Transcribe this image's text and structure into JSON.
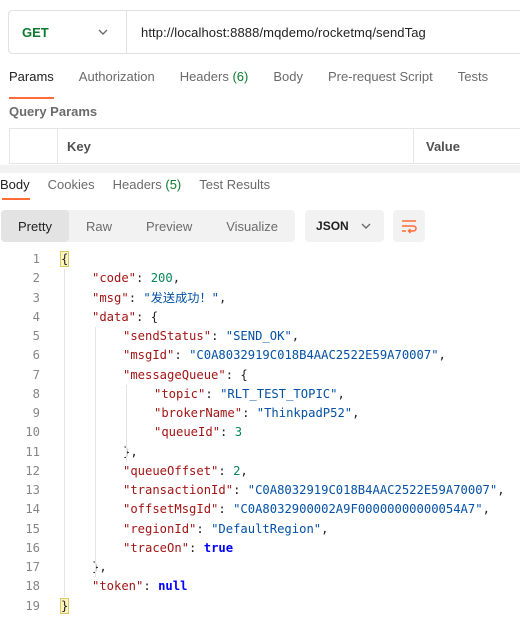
{
  "request": {
    "method": "GET",
    "url": "http://localhost:8888/mqdemo/rocketmq/sendTag"
  },
  "request_tabs": [
    {
      "label": "Params",
      "count": ""
    },
    {
      "label": "Authorization",
      "count": ""
    },
    {
      "label": "Headers",
      "count": "(6)"
    },
    {
      "label": "Body",
      "count": ""
    },
    {
      "label": "Pre-request Script",
      "count": ""
    },
    {
      "label": "Tests",
      "count": ""
    }
  ],
  "query_params": {
    "title": "Query Params",
    "columns": {
      "key": "Key",
      "value": "Value"
    }
  },
  "response_tabs": [
    {
      "label": "Body",
      "count": ""
    },
    {
      "label": "Cookies",
      "count": ""
    },
    {
      "label": "Headers",
      "count": "(5)"
    },
    {
      "label": "Test Results",
      "count": ""
    }
  ],
  "view_modes": [
    "Pretty",
    "Raw",
    "Preview",
    "Visualize"
  ],
  "active_view": "Pretty",
  "format": "JSON",
  "icons": {
    "method_dropdown": "chevron-down-icon",
    "format_dropdown": "chevron-down-icon",
    "wrap": "wrap-lines-icon"
  },
  "colors": {
    "accent": "#ff6c37",
    "get_method": "#0c7b2f",
    "json_key": "#a31515",
    "json_string": "#0451a5",
    "json_number": "#098658",
    "json_literal": "#0000ff"
  },
  "code_lines": [
    {
      "n": "1",
      "depth": 0,
      "tokens": [
        {
          "t": "{",
          "c": "p",
          "hl": true
        }
      ]
    },
    {
      "n": "2",
      "depth": 1,
      "tokens": [
        {
          "t": "\"code\"",
          "c": "k"
        },
        {
          "t": ": ",
          "c": "p"
        },
        {
          "t": "200",
          "c": "n"
        },
        {
          "t": ",",
          "c": "p"
        }
      ]
    },
    {
      "n": "3",
      "depth": 1,
      "tokens": [
        {
          "t": "\"msg\"",
          "c": "k"
        },
        {
          "t": ": ",
          "c": "p"
        },
        {
          "t": "\"发送成功！\"",
          "c": "s"
        },
        {
          "t": ",",
          "c": "p"
        }
      ]
    },
    {
      "n": "4",
      "depth": 1,
      "tokens": [
        {
          "t": "\"data\"",
          "c": "k"
        },
        {
          "t": ": {",
          "c": "p"
        }
      ]
    },
    {
      "n": "5",
      "depth": 2,
      "tokens": [
        {
          "t": "\"sendStatus\"",
          "c": "k"
        },
        {
          "t": ": ",
          "c": "p"
        },
        {
          "t": "\"SEND_OK\"",
          "c": "s"
        },
        {
          "t": ",",
          "c": "p"
        }
      ]
    },
    {
      "n": "6",
      "depth": 2,
      "tokens": [
        {
          "t": "\"msgId\"",
          "c": "k"
        },
        {
          "t": ": ",
          "c": "p"
        },
        {
          "t": "\"C0A8032919C018B4AAC2522E59A70007\"",
          "c": "s"
        },
        {
          "t": ",",
          "c": "p"
        }
      ]
    },
    {
      "n": "7",
      "depth": 2,
      "tokens": [
        {
          "t": "\"messageQueue\"",
          "c": "k"
        },
        {
          "t": ": {",
          "c": "p"
        }
      ]
    },
    {
      "n": "8",
      "depth": 3,
      "tokens": [
        {
          "t": "\"topic\"",
          "c": "k"
        },
        {
          "t": ": ",
          "c": "p"
        },
        {
          "t": "\"RLT_TEST_TOPIC\"",
          "c": "s"
        },
        {
          "t": ",",
          "c": "p"
        }
      ]
    },
    {
      "n": "9",
      "depth": 3,
      "tokens": [
        {
          "t": "\"brokerName\"",
          "c": "k"
        },
        {
          "t": ": ",
          "c": "p"
        },
        {
          "t": "\"ThinkpadP52\"",
          "c": "s"
        },
        {
          "t": ",",
          "c": "p"
        }
      ]
    },
    {
      "n": "10",
      "depth": 3,
      "tokens": [
        {
          "t": "\"queueId\"",
          "c": "k"
        },
        {
          "t": ": ",
          "c": "p"
        },
        {
          "t": "3",
          "c": "n"
        }
      ]
    },
    {
      "n": "11",
      "depth": 2,
      "tokens": [
        {
          "t": "},",
          "c": "p"
        }
      ]
    },
    {
      "n": "12",
      "depth": 2,
      "tokens": [
        {
          "t": "\"queueOffset\"",
          "c": "k"
        },
        {
          "t": ": ",
          "c": "p"
        },
        {
          "t": "2",
          "c": "n"
        },
        {
          "t": ",",
          "c": "p"
        }
      ]
    },
    {
      "n": "13",
      "depth": 2,
      "tokens": [
        {
          "t": "\"transactionId\"",
          "c": "k"
        },
        {
          "t": ": ",
          "c": "p"
        },
        {
          "t": "\"C0A8032919C018B4AAC2522E59A70007\"",
          "c": "s"
        },
        {
          "t": ",",
          "c": "p"
        }
      ]
    },
    {
      "n": "14",
      "depth": 2,
      "tokens": [
        {
          "t": "\"offsetMsgId\"",
          "c": "k"
        },
        {
          "t": ": ",
          "c": "p"
        },
        {
          "t": "\"C0A8032900002A9F00000000000054A7\"",
          "c": "s"
        },
        {
          "t": ",",
          "c": "p"
        }
      ]
    },
    {
      "n": "15",
      "depth": 2,
      "tokens": [
        {
          "t": "\"regionId\"",
          "c": "k"
        },
        {
          "t": ": ",
          "c": "p"
        },
        {
          "t": "\"DefaultRegion\"",
          "c": "s"
        },
        {
          "t": ",",
          "c": "p"
        }
      ]
    },
    {
      "n": "16",
      "depth": 2,
      "tokens": [
        {
          "t": "\"traceOn\"",
          "c": "k"
        },
        {
          "t": ": ",
          "c": "p"
        },
        {
          "t": "true",
          "c": "b"
        }
      ]
    },
    {
      "n": "17",
      "depth": 1,
      "tokens": [
        {
          "t": "},",
          "c": "p"
        }
      ]
    },
    {
      "n": "18",
      "depth": 1,
      "tokens": [
        {
          "t": "\"token\"",
          "c": "k"
        },
        {
          "t": ": ",
          "c": "p"
        },
        {
          "t": "null",
          "c": "b"
        }
      ]
    },
    {
      "n": "19",
      "depth": 0,
      "tokens": [
        {
          "t": "}",
          "c": "p",
          "hl": true
        }
      ]
    }
  ]
}
